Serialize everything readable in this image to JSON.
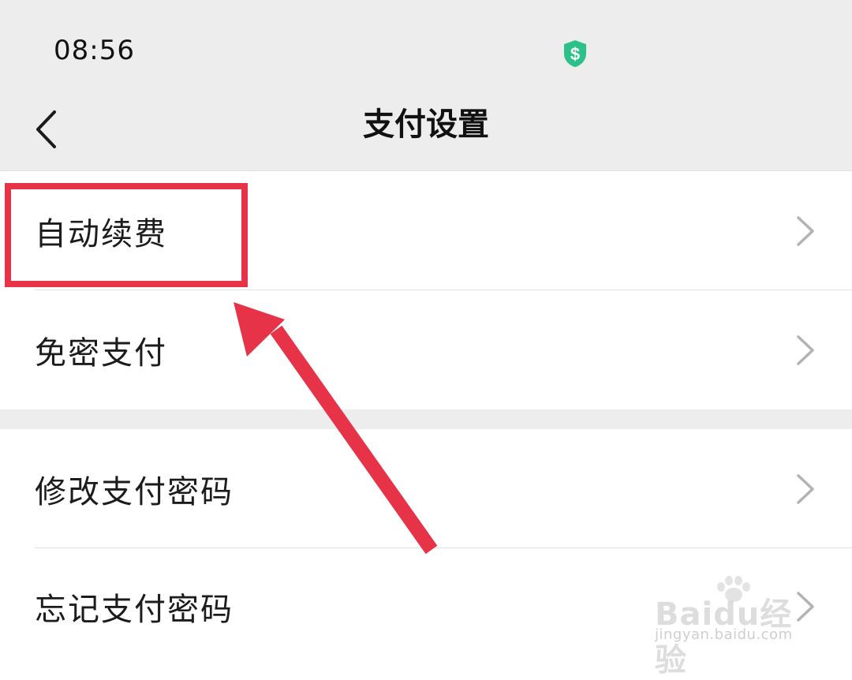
{
  "status_bar": {
    "time": "08:56",
    "icons": [
      "wallet-shield-icon"
    ]
  },
  "header": {
    "title": "支付设置",
    "back_icon": "chevron-left-icon"
  },
  "settings": {
    "group1": [
      {
        "label": "自动续费",
        "icon": "chevron-right-icon"
      },
      {
        "label": "免密支付",
        "icon": "chevron-right-icon"
      }
    ],
    "group2": [
      {
        "label": "修改支付密码",
        "icon": "chevron-right-icon"
      },
      {
        "label": "忘记支付密码",
        "icon": "chevron-right-icon"
      }
    ]
  },
  "annotation": {
    "highlight_color": "#e63347",
    "arrow_color": "#e63347"
  },
  "watermark": {
    "brand": "Baidu经验",
    "url": "jingyan.baidu.com"
  },
  "colors": {
    "background_gray": "#ededed",
    "accent_green": "#2dc18a",
    "text_primary": "#1c1c1c",
    "chevron": "#b3b3b3"
  }
}
